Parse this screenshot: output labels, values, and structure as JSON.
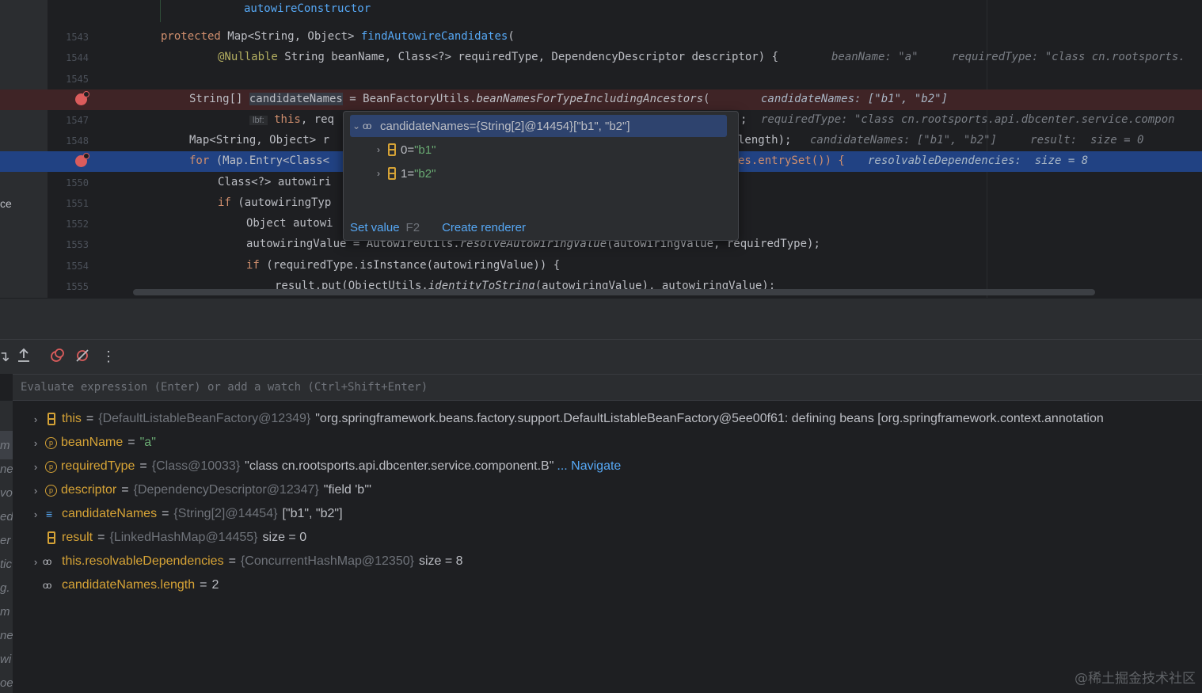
{
  "editor": {
    "top_snippet": "autowireConstructor",
    "left_fragment": "ce",
    "lines": [
      {
        "num": "1543"
      },
      {
        "num": "1544"
      },
      {
        "num": "1545"
      },
      {
        "num": ""
      },
      {
        "num": "1547"
      },
      {
        "num": "1548"
      },
      {
        "num": ""
      },
      {
        "num": "1550"
      },
      {
        "num": "1551"
      },
      {
        "num": "1552"
      },
      {
        "num": "1553"
      },
      {
        "num": "1554"
      },
      {
        "num": "1555"
      }
    ],
    "code": {
      "l1543_kw": "protected",
      "l1543_a": " Map<String, Object> ",
      "l1543_fn": "findAutowireCandidates",
      "l1543_b": "(",
      "l1544_ann": "@Nullable",
      "l1544_a": " String beanName, Class<?> requiredType, DependencyDescriptor descriptor) {",
      "l1544_hint": "beanName: \"a\"     requiredType: \"class cn.rootsports.",
      "l1546_a": "String[] ",
      "l1546_sel": "candidateNames",
      "l1546_b": " = BeanFactoryUtils.",
      "l1546_it": "beanNamesForTypeIncludingAncestors",
      "l1546_c": "(",
      "l1546_hint": "candidateNames: [\"b1\", \"b2\"]",
      "l1547_lbf": "lbf:",
      "l1547_kw": "this",
      "l1547_a": ", req",
      "l1547_tail": ";",
      "l1547_hint": "requiredType: \"class cn.rootsports.api.dbcenter.service.compon",
      "l1548_a": "Map<String, Object> r",
      "l1548_tail": "length);",
      "l1548_hint": "candidateNames: [\"b1\", \"b2\"]     result:  size = 0",
      "l1549_kw": "for",
      "l1549_a": " (Map.Entry<Class<",
      "l1549_tail": "es.entrySet()) {",
      "l1549_hint": "resolvableDependencies:  size = 8",
      "l1550_a": "Class<?> autowiri",
      "l1551_kw": "if",
      "l1551_a": " (autowiringTyp",
      "l1552_a": "Object autowi",
      "l1553_a": "autowiringValue = AutowireUtils.",
      "l1553_it": "resolveAutowiringValue",
      "l1553_b": "(autowiringValue, requiredType);",
      "l1554_kw": "if",
      "l1554_a": " (requiredType.isInstance(autowiringValue)) {",
      "l1555_a": "result.put(ObjectUtils.",
      "l1555_it": "identityToString",
      "l1555_b": "(autowiringValue), autowiringValue);"
    }
  },
  "popup": {
    "root": {
      "name": "candidateNames",
      "eq": " = ",
      "type": "{String[2]@14454}",
      "value": " [\"b1\", \"b2\"]"
    },
    "children": [
      {
        "index": "0",
        "eq": " = ",
        "value": "\"b1\""
      },
      {
        "index": "1",
        "eq": " = ",
        "value": "\"b2\""
      }
    ],
    "set_value_label": "Set value",
    "set_value_key": "F2",
    "create_renderer_label": "Create renderer"
  },
  "debug": {
    "eval_placeholder": "Evaluate expression (Enter) or add a watch (Ctrl+Shift+Enter)",
    "frames_fragments": [
      "m",
      "ne",
      "vo",
      "ed",
      "er",
      "tic",
      "g.",
      "m",
      "ne",
      "wi",
      "oe"
    ],
    "variables": [
      {
        "name": "this",
        "type": "{DefaultListableBeanFactory@12349}",
        "value": "\"org.springframework.beans.factory.support.DefaultListableBeanFactory@5ee00f61: defining beans [org.springframework.context.annotation"
      },
      {
        "name": "beanName",
        "type": "",
        "value": "\"a\""
      },
      {
        "name": "requiredType",
        "type": "{Class@10033}",
        "value": "\"class cn.rootsports.api.dbcenter.service.component.B\"",
        "extra": "... Navigate"
      },
      {
        "name": "descriptor",
        "type": "{DependencyDescriptor@12347}",
        "value": "\"field 'b'\""
      },
      {
        "name": "candidateNames",
        "type": "{String[2]@14454}",
        "value": "[\"b1\", \"b2\"]"
      },
      {
        "name": "result",
        "type": "{LinkedHashMap@14455}",
        "value": " size = 0"
      },
      {
        "name": "this.resolvableDependencies",
        "type": "{ConcurrentHashMap@12350}",
        "value": " size = 8"
      },
      {
        "name": "candidateNames.length",
        "type": "",
        "value": "2"
      }
    ]
  },
  "watermark": "@稀土掘金技术社区",
  "colors": {
    "background": "#1e1f22",
    "panel": "#2b2d30",
    "accent": "#56a8f5",
    "breakpoint": "#db5c5c",
    "current_line": "#214283",
    "var_name": "#d6a336",
    "string": "#6aab73"
  },
  "icons": [
    "breakpoint-icon",
    "glasses-watch-icon",
    "array-field-icon",
    "parameter-icon",
    "list-icon",
    "step-out-icon",
    "mute-breakpoints-icon",
    "more-options-icon"
  ]
}
